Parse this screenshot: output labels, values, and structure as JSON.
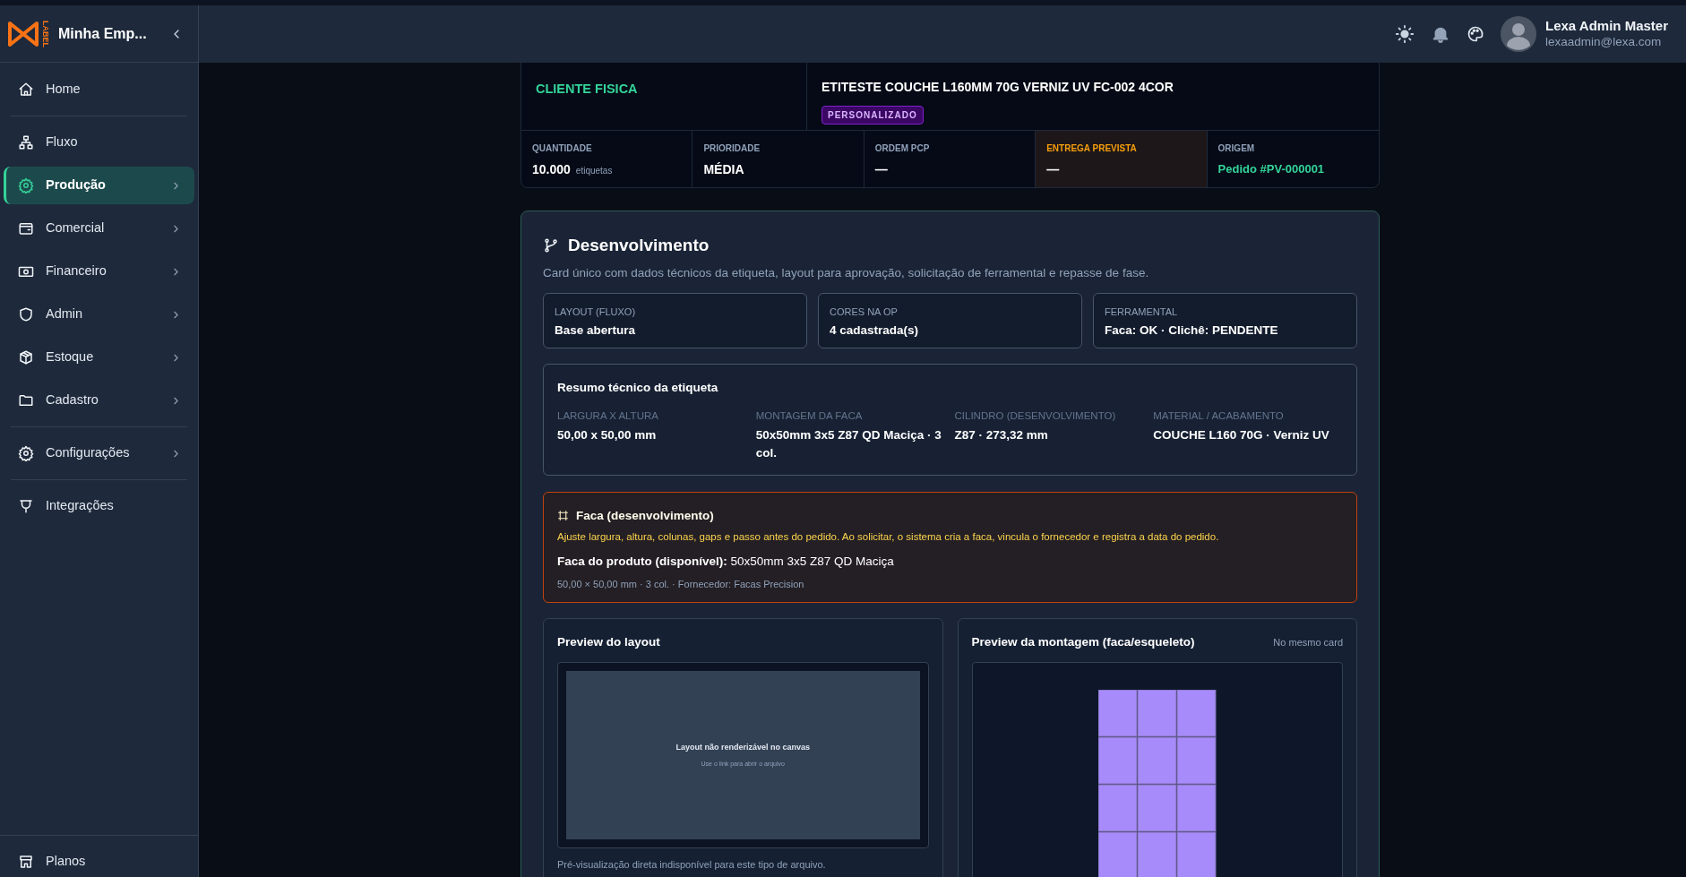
{
  "brand": {
    "logo_text": "LABEL",
    "name": "Minha Emp..."
  },
  "sidebar": {
    "groups": [
      [
        {
          "label": "Home",
          "selected": false,
          "has_submenu": false
        }
      ],
      [
        {
          "label": "Fluxo",
          "selected": false,
          "has_submenu": false
        },
        {
          "label": "Produção",
          "selected": true,
          "has_submenu": true
        },
        {
          "label": "Comercial",
          "selected": false,
          "has_submenu": true
        },
        {
          "label": "Financeiro",
          "selected": false,
          "has_submenu": true
        },
        {
          "label": "Admin",
          "selected": false,
          "has_submenu": true
        },
        {
          "label": "Estoque",
          "selected": false,
          "has_submenu": true
        },
        {
          "label": "Cadastro",
          "selected": false,
          "has_submenu": true
        }
      ],
      [
        {
          "label": "Configurações",
          "selected": false,
          "has_submenu": true
        }
      ],
      [
        {
          "label": "Integrações",
          "selected": false,
          "has_submenu": false
        }
      ]
    ],
    "footer_items": [
      {
        "label": "Planos",
        "selected": false,
        "has_submenu": false
      }
    ]
  },
  "header": {
    "user": {
      "name": "Lexa Admin Master",
      "email": "lexaadmin@lexa.com"
    }
  },
  "order_card": {
    "client": "CLIENTE FISICA",
    "product": "ETITESTE COUCHE L160MM 70G VERNIZ UV FC-002 4COR",
    "product_tag": "PERSONALIZADO",
    "fields": [
      {
        "label": "QUANTIDADE",
        "value": "10.000",
        "unit": "etiquetas",
        "kind": "strong",
        "highlighted": false
      },
      {
        "label": "PRIORIDADE",
        "value": "MÉDIA",
        "kind": "strong",
        "highlighted": false
      },
      {
        "label": "ORDEM PCP",
        "value": "—",
        "kind": "strong",
        "highlighted": false
      },
      {
        "label": "ENTREGA PREVISTA",
        "value": "—",
        "kind": "strong",
        "highlighted": true
      },
      {
        "label": "ORIGEM",
        "value": "Pedido #PV-000001",
        "kind": "link",
        "highlighted": false
      }
    ]
  },
  "development": {
    "title": "Desenvolvimento",
    "subtitle": "Card único com dados técnicos da etiqueta, layout para aprovação, solicitação de ferramental e repasse de fase.",
    "info_boxes": [
      {
        "label": "LAYOUT (FLUXO)",
        "value": "Base abertura"
      },
      {
        "label": "CORES NA OP",
        "value": "4 cadastrada(s)"
      },
      {
        "label": "FERRAMENTAL",
        "value": "Faca: OK · Clichê: PENDENTE"
      }
    ],
    "summary": {
      "title": "Resumo técnico da etiqueta",
      "fields": [
        {
          "label": "LARGURA X ALTURA",
          "value": "50,00 x 50,00 mm"
        },
        {
          "label": "MONTAGEM DA FACA",
          "value": "50x50mm 3x5 Z87 QD Maciça · 3 col."
        },
        {
          "label": "CILINDRO (DESENVOLVIMENTO)",
          "value": "Z87 · 273,32 mm"
        },
        {
          "label": "MATERIAL / ACABAMENTO",
          "value": "COUCHE L160 70G · Verniz UV"
        }
      ]
    },
    "faca": {
      "title": "Faca (desenvolvimento)",
      "description": "Ajuste largura, altura, colunas, gaps e passo antes do pedido. Ao solicitar, o sistema cria a faca, vincula o fornecedor e registra a data do pedido.",
      "product_line": "**Faca do produto (disponível):** 50x50mm 3x5 Z87 QD Maciça",
      "details": "50,00 × 50,00 mm · 3 col. · Fornecedor: Facas Precision"
    },
    "layout_preview": {
      "title": "Preview do layout",
      "message": "Layout não renderizável no canvas",
      "hint": "Use o link para abrir o arquivo",
      "caption": "Pré-visualização direta indisponível para este tipo de arquivo."
    },
    "montage_preview": {
      "title": "Preview da montagem (faca/esqueleto)",
      "note": "No mesmo card"
    }
  }
}
